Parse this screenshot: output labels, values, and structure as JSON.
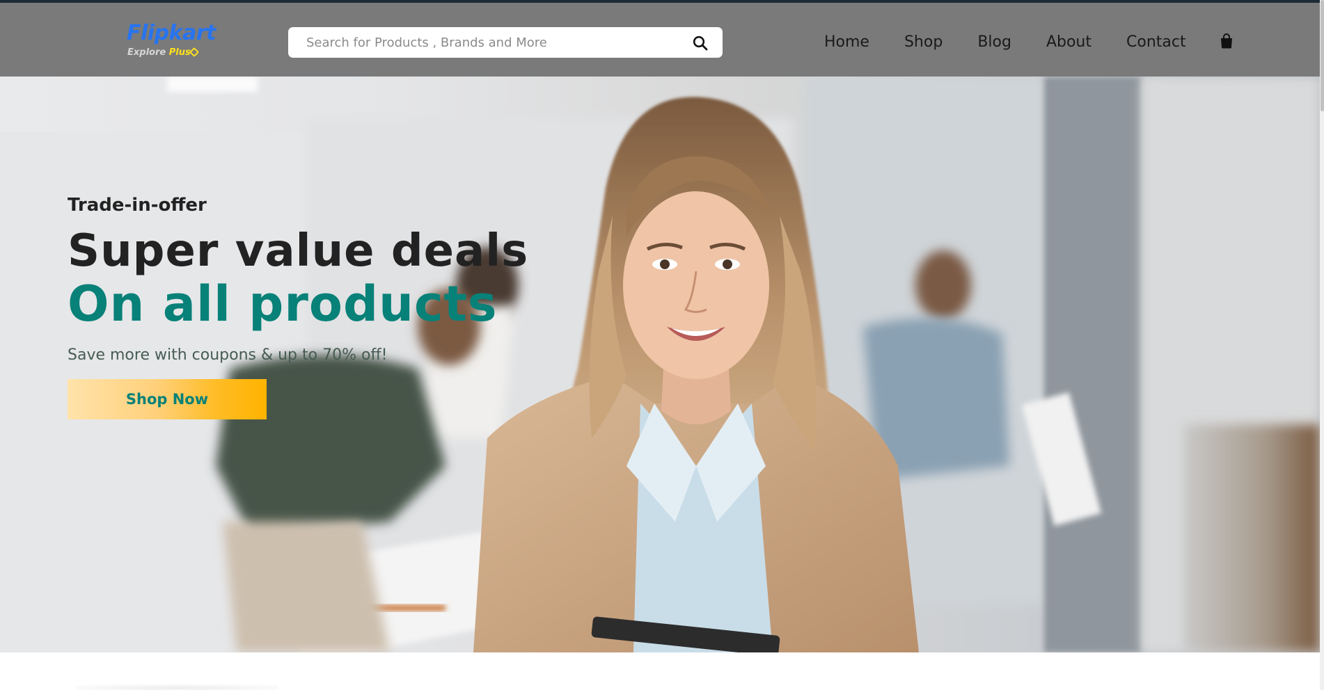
{
  "brand": {
    "name": "Flipkart",
    "tagline_prefix": "Explore",
    "tagline_highlight": "Plus",
    "colors": {
      "primary": "#2874f0",
      "accent": "#ffe11b"
    }
  },
  "search": {
    "placeholder": "Search for Products , Brands and More",
    "value": "",
    "icon": "search-icon"
  },
  "nav": {
    "items": [
      {
        "label": "Home"
      },
      {
        "label": "Shop"
      },
      {
        "label": "Blog"
      },
      {
        "label": "About"
      },
      {
        "label": "Contact"
      }
    ],
    "cart_icon": "shopping-bag-icon"
  },
  "hero": {
    "kicker": "Trade-in-offer",
    "headline": "Super value deals",
    "headline_accent": "On all products",
    "subtext": "Save more with coupons & up to 70% off!",
    "cta_label": "Shop Now",
    "colors": {
      "accent": "#088178",
      "text": "#222222",
      "cta_gradient_end": "#ffb300"
    }
  },
  "theme": {
    "header_bg": "#7a7a7a"
  }
}
